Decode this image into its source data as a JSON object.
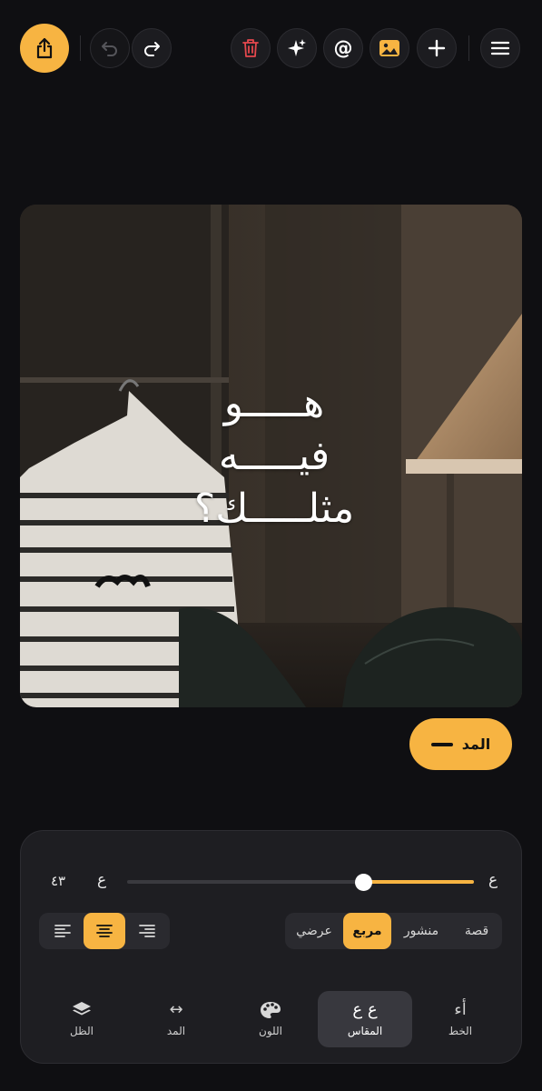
{
  "toolbar": {
    "share": "share-icon",
    "undo": "undo-icon",
    "redo": "redo-icon",
    "delete": "trash-icon",
    "magic": "sparkles-icon",
    "mention": "at-icon",
    "mention_glyph": "@",
    "image": "image-icon",
    "add": "plus-icon",
    "menu": "menu-icon"
  },
  "canvas": {
    "text_lines": [
      "هـــــو",
      "فيـــــه",
      "مثلـــــك؟"
    ]
  },
  "stretch_button": {
    "label": "المد"
  },
  "slider": {
    "right_label": "ع",
    "left_label": "ع",
    "value_label": "٤٣",
    "fraction": 0.68
  },
  "formats": [
    {
      "label": "قصة",
      "active": false
    },
    {
      "label": "منشور",
      "active": false
    },
    {
      "label": "مربع",
      "active": true
    },
    {
      "label": "عرضي",
      "active": false
    }
  ],
  "alignment": {
    "options": [
      "align-right-icon",
      "align-center-icon",
      "align-left-icon"
    ],
    "active": "center"
  },
  "tabs": [
    {
      "label": "الخط",
      "glyph": "أء",
      "active": false
    },
    {
      "label": "المقاس",
      "glyph": "ع ع",
      "active": true
    },
    {
      "label": "اللون",
      "glyph": "palette-icon",
      "active": false
    },
    {
      "label": "المد",
      "glyph": "↔",
      "active": false
    },
    {
      "label": "الظل",
      "glyph": "layers-icon",
      "active": false
    }
  ],
  "colors": {
    "accent": "#f7b442",
    "background": "#0f0f12",
    "panel": "#1e1e22"
  }
}
